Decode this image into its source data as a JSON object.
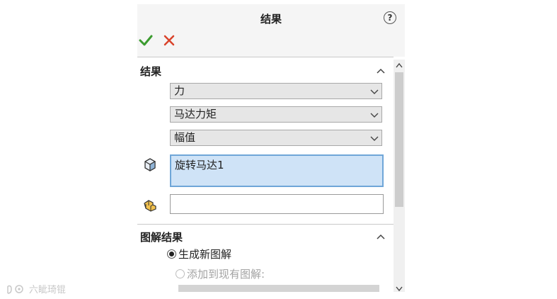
{
  "panel": {
    "title": "结果",
    "help_label": "?"
  },
  "results_section": {
    "title": "结果",
    "dropdowns": [
      {
        "selected": "力"
      },
      {
        "selected": "马达力矩"
      },
      {
        "selected": "幅值"
      }
    ],
    "selection_value": "旋转马达1",
    "face_selection_value": ""
  },
  "plot_section": {
    "title": "图解结果",
    "options": [
      {
        "label": "生成新图解",
        "checked": true,
        "enabled": true
      },
      {
        "label": "添加到现有图解:",
        "checked": false,
        "enabled": false
      }
    ]
  },
  "watermark": {
    "text": "六眦琦锟"
  },
  "colors": {
    "ok_green": "#3b9b2f",
    "cancel_red": "#d9432b",
    "selection_fill": "#cfe3f7",
    "selection_border": "#6fa6d8"
  },
  "icons": [
    "check-icon",
    "close-icon",
    "help-icon",
    "chevron-up-icon",
    "chevron-down-icon",
    "part-icon",
    "face-icon"
  ]
}
